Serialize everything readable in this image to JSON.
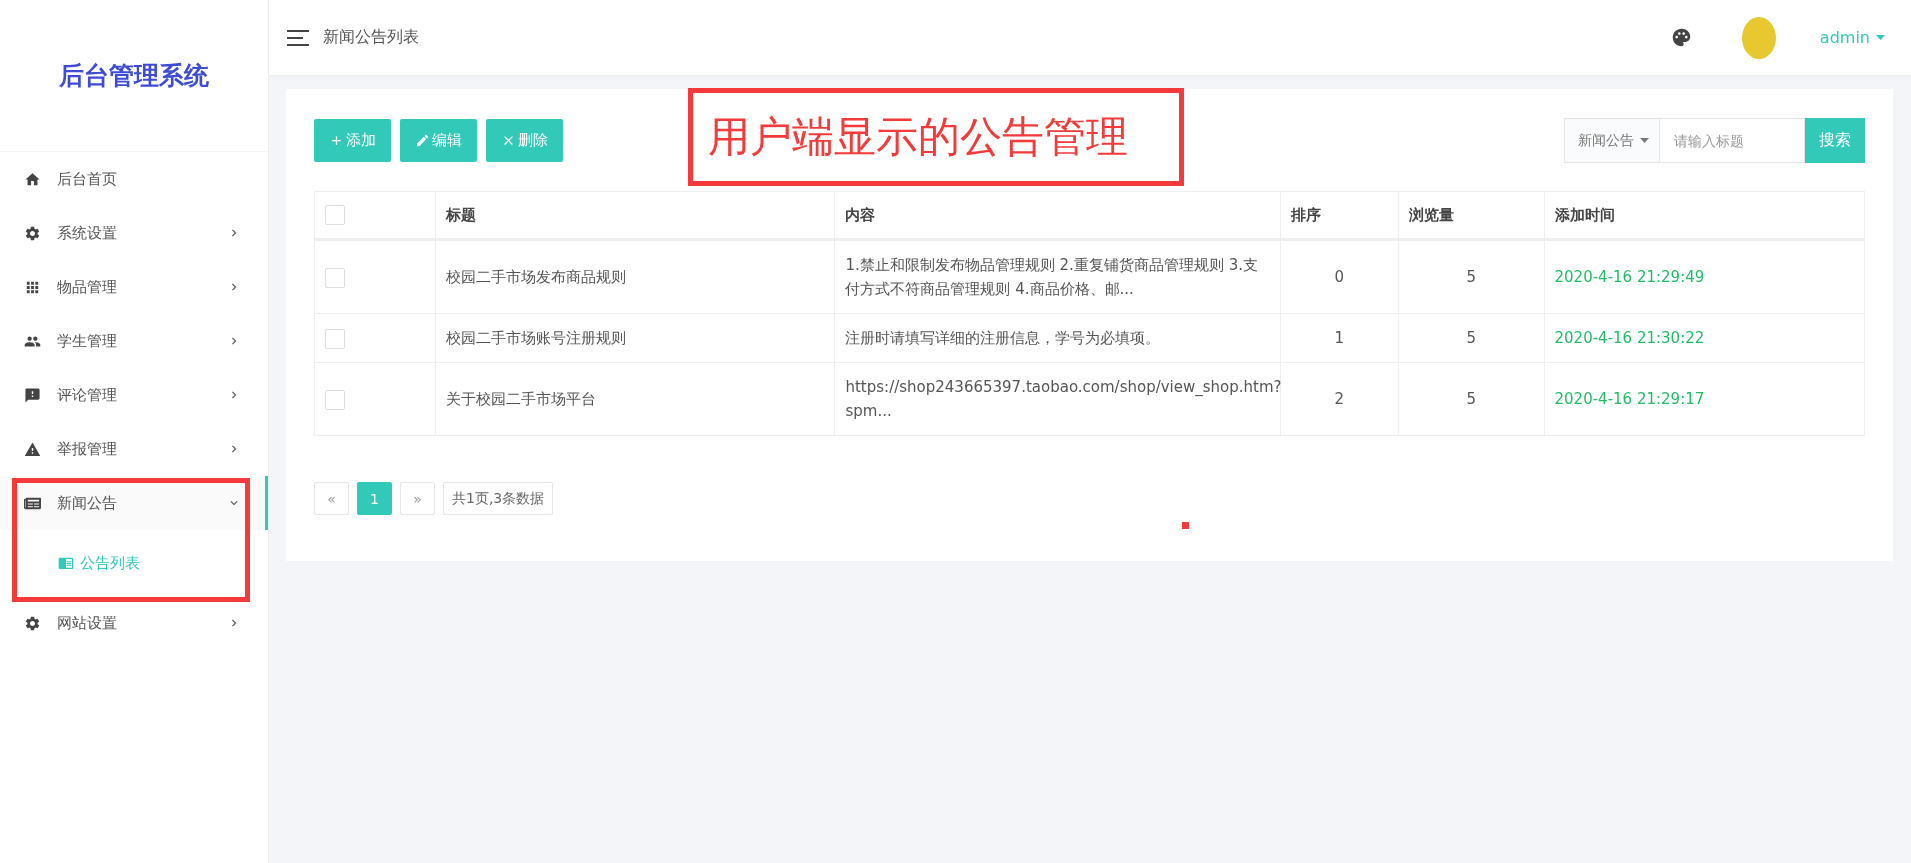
{
  "sidebar": {
    "logo": "后台管理系统",
    "items": [
      {
        "label": "后台首页",
        "kind": "link"
      },
      {
        "label": "系统设置",
        "kind": "group",
        "expanded": false
      },
      {
        "label": "物品管理",
        "kind": "group",
        "expanded": false
      },
      {
        "label": "学生管理",
        "kind": "group",
        "expanded": false
      },
      {
        "label": "评论管理",
        "kind": "group",
        "expanded": false
      },
      {
        "label": "举报管理",
        "kind": "group",
        "expanded": false
      },
      {
        "label": "新闻公告",
        "kind": "group",
        "expanded": true,
        "children": [
          {
            "label": "公告列表",
            "selected": true
          }
        ]
      },
      {
        "label": "网站设置",
        "kind": "group",
        "expanded": false
      }
    ]
  },
  "header": {
    "title": "新闻公告列表",
    "user": "admin"
  },
  "toolbar": {
    "buttons": [
      {
        "label": "添加",
        "kind": "add"
      },
      {
        "label": "编辑",
        "kind": "edit"
      },
      {
        "label": "删除",
        "kind": "delete"
      }
    ],
    "search": {
      "category": "新闻公告",
      "placeholder": "请输入标题",
      "button": "搜索"
    }
  },
  "table": {
    "all_checked": false,
    "columns": [
      "标题",
      "内容",
      "排序",
      "浏览量",
      "添加时间"
    ],
    "rows": [
      {
        "checked": false,
        "title": "校园二手市场发布商品规则",
        "content": "1.禁止和限制发布物品管理规则 2.重复铺货商品管理规则 3.支付方式不符商品管理规则 4.商品价格、邮...",
        "order": "0",
        "views": "5",
        "time": "2020-4-16 21:29:49"
      },
      {
        "checked": false,
        "title": "校园二手市场账号注册规则",
        "content": "注册时请填写详细的注册信息，学号为必填项。",
        "order": "1",
        "views": "5",
        "time": "2020-4-16 21:30:22"
      },
      {
        "checked": false,
        "title": "关于校园二手市场平台",
        "content": "https://shop243665397.taobao.com/shop/view_shop.htm?spm...",
        "order": "2",
        "views": "5",
        "time": "2020-4-16 21:29:17"
      }
    ]
  },
  "pagination": {
    "prev": "«",
    "pages": [
      {
        "label": "1",
        "selected": true
      }
    ],
    "next": "»",
    "summary": "共1页,3条数据"
  },
  "annotation": {
    "text": "用户端显示的公告管理"
  }
}
